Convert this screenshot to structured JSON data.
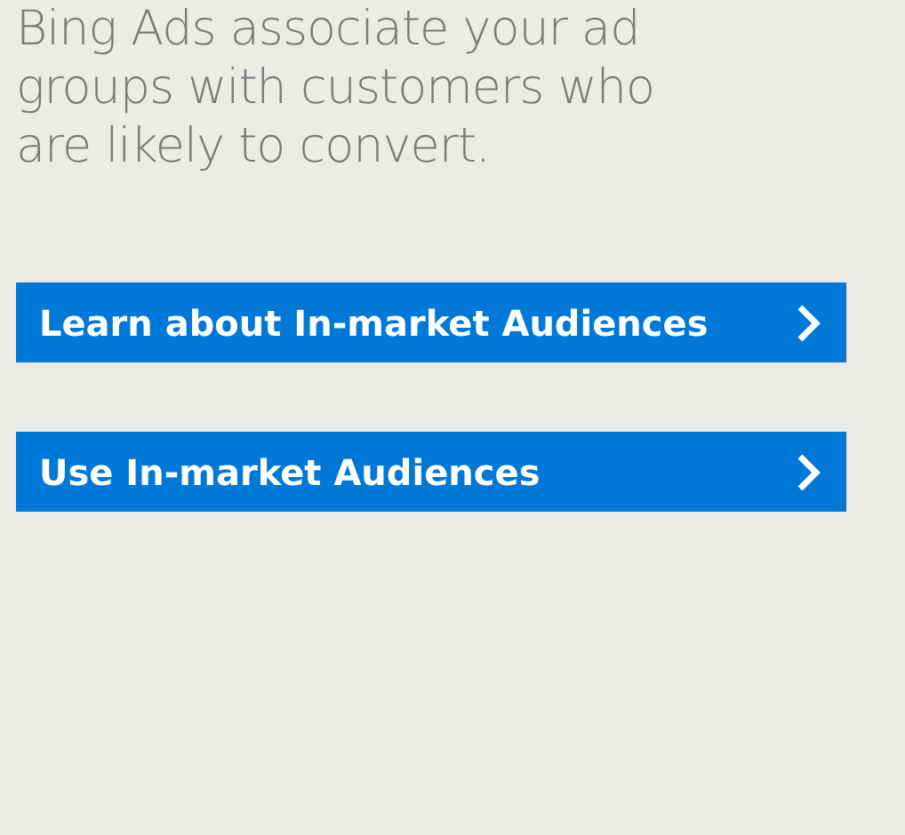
{
  "description": {
    "lines": [
      "Bing Ads associate your ad",
      "groups with customers who",
      "are likely to convert."
    ]
  },
  "buttons": [
    {
      "label": "Learn about In-market Audiences"
    },
    {
      "label": "Use In-market Audiences"
    }
  ]
}
